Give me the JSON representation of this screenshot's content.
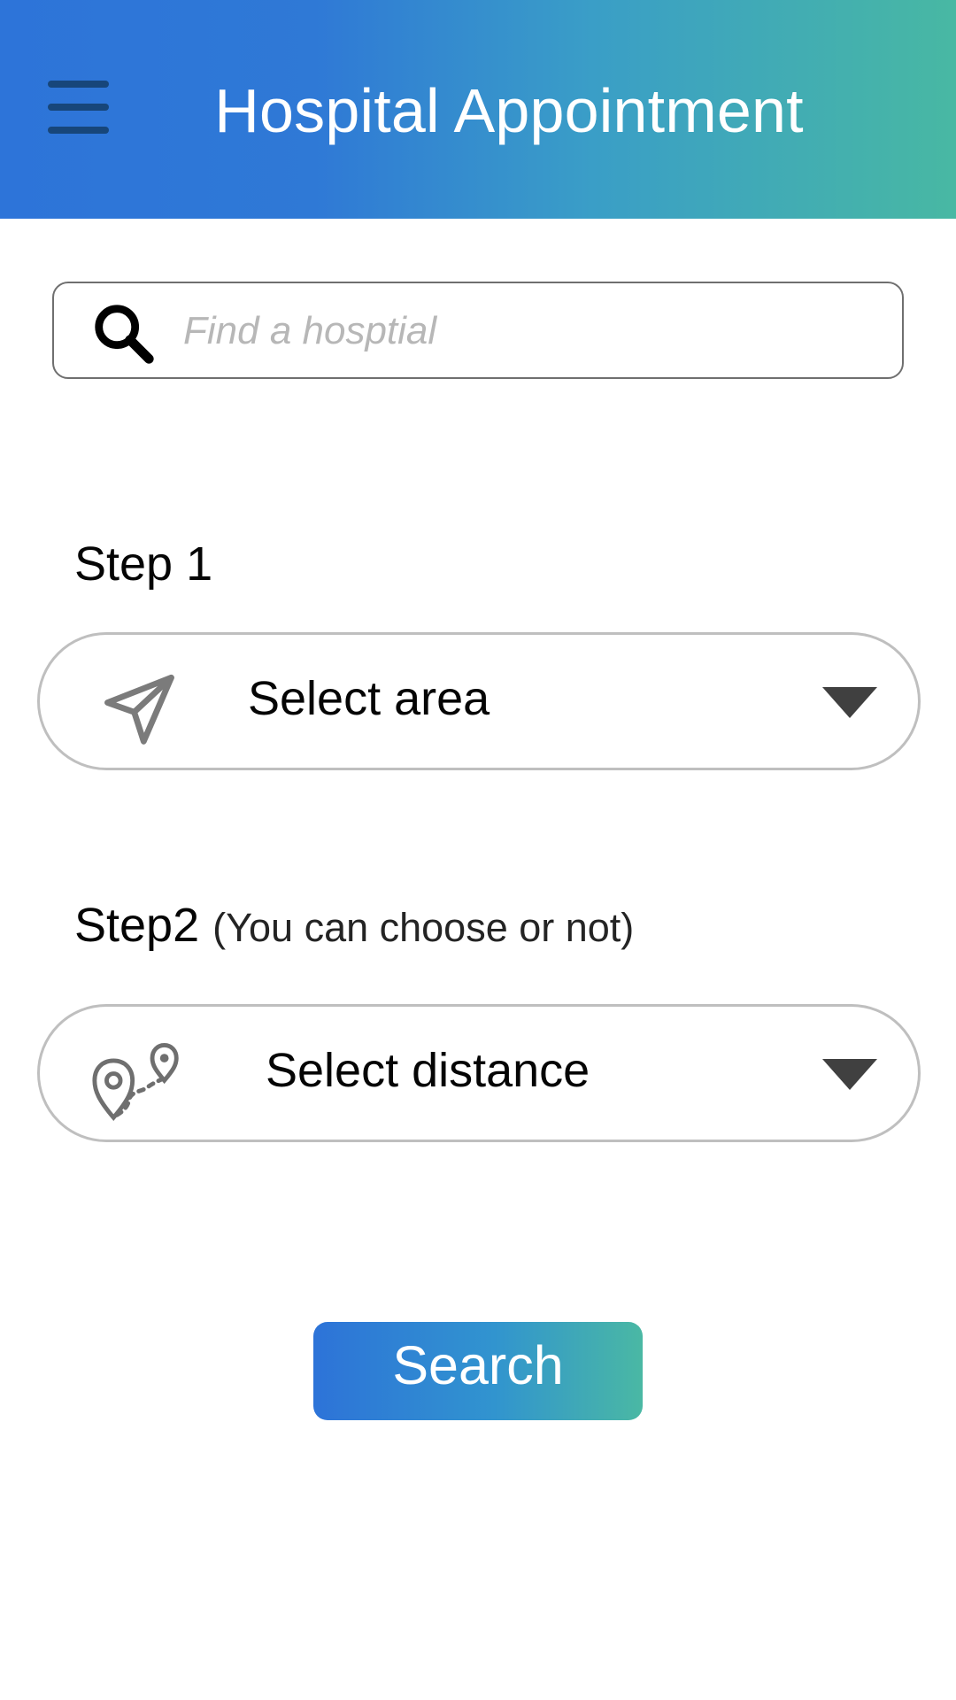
{
  "header": {
    "title": "Hospital Appointment",
    "gradient_start": "#2d74d9",
    "gradient_end": "#48b8a3",
    "menu_icon": "hamburger-menu-icon",
    "menu_icon_color": "#17467a"
  },
  "search": {
    "placeholder": "Find a hosptial",
    "value": "",
    "icon": "search-icon"
  },
  "steps": {
    "step1": {
      "label": "Step 1",
      "select_label": "Select area",
      "icon": "send-location-icon",
      "dropdown_icon": "chevron-down-icon"
    },
    "step2": {
      "label": "Step2",
      "note": "(You can choose or not)",
      "select_label": "Select distance",
      "icon": "route-distance-icon",
      "dropdown_icon": "chevron-down-icon"
    }
  },
  "action": {
    "search_label": "Search",
    "gradient_start": "#2d73d8",
    "gradient_end": "#4ab8a4"
  },
  "colors": {
    "background": "#ffffff",
    "text": "#050505",
    "placeholder": "#b7b7b7",
    "border": "#bfbfbf",
    "icon_gray": "#7b7b7b",
    "arrow": "#404040"
  }
}
